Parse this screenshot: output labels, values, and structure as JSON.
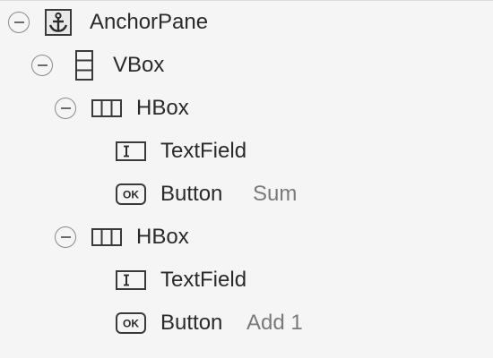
{
  "tree": {
    "nodes": [
      {
        "label": "AnchorPane",
        "icon": "anchor-icon",
        "expanded": true
      },
      {
        "label": "VBox",
        "icon": "vbox-icon",
        "expanded": true
      },
      {
        "label": "HBox",
        "icon": "hbox-icon",
        "expanded": true
      },
      {
        "label": "TextField",
        "icon": "textfield-icon"
      },
      {
        "label": "Button",
        "icon": "button-ok-icon",
        "detail": "Sum"
      },
      {
        "label": "HBox",
        "icon": "hbox-icon",
        "expanded": true
      },
      {
        "label": "TextField",
        "icon": "textfield-icon"
      },
      {
        "label": "Button",
        "icon": "button-ok-icon",
        "detail": "Add 1"
      }
    ]
  }
}
